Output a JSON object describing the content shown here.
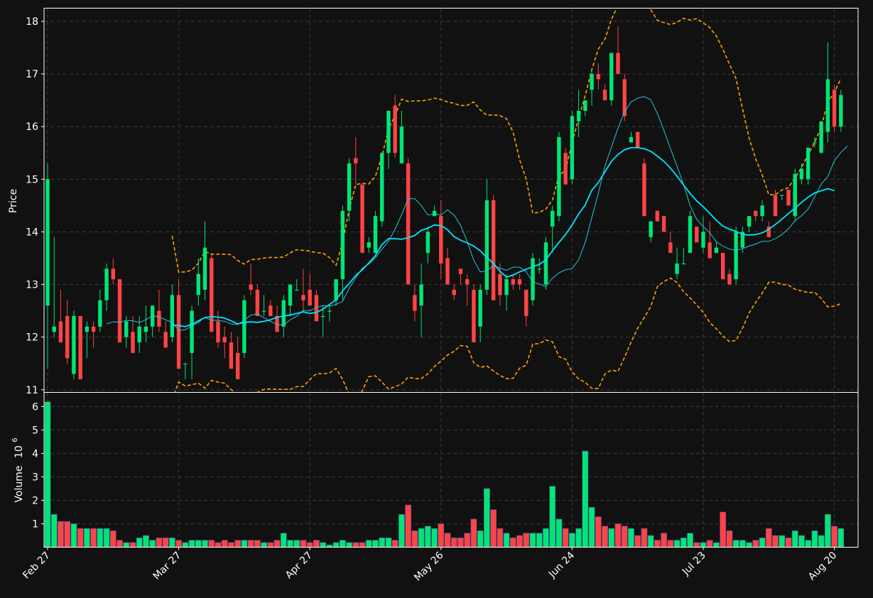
{
  "chart_data": {
    "type": "candlestick",
    "colors": {
      "background": "#111111",
      "up": "#00e676",
      "down": "#ff4444",
      "frame": "#ffffff",
      "grid": "#3a3a3a",
      "bollinger": "#ffa000",
      "ma_short": "#26c6da",
      "ma_long": "#00e5ff"
    },
    "price_panel": {
      "ylabel": "Price",
      "ylim": [
        10.95,
        18.25
      ],
      "yticks": [
        11,
        12,
        13,
        14,
        15,
        16,
        17,
        18
      ]
    },
    "volume_panel": {
      "ylabel": "Volume",
      "ylabel_exponent": "10",
      "ylabel_exponent_power": "6",
      "ylim": [
        0,
        6.6
      ],
      "yticks": [
        1,
        2,
        3,
        4,
        5,
        6
      ]
    },
    "xtick_labels": [
      {
        "index": 0,
        "label": "Feb 27"
      },
      {
        "index": 20,
        "label": "Mar 27"
      },
      {
        "index": 40,
        "label": "Apr 27"
      },
      {
        "index": 60,
        "label": "May 26"
      },
      {
        "index": 80,
        "label": "Jun 24"
      },
      {
        "index": 100,
        "label": "Jul 23"
      },
      {
        "index": 120,
        "label": "Aug 20"
      }
    ],
    "ohlc": [
      [
        12.6,
        15.3,
        11.4,
        15.0
      ],
      [
        12.1,
        13.9,
        12.0,
        12.2
      ],
      [
        12.3,
        12.9,
        11.9,
        11.9
      ],
      [
        12.4,
        12.7,
        11.5,
        11.6
      ],
      [
        11.3,
        12.5,
        11.2,
        12.4
      ],
      [
        12.4,
        12.4,
        11.2,
        11.2
      ],
      [
        12.1,
        12.3,
        11.6,
        12.2
      ],
      [
        12.2,
        12.3,
        11.8,
        12.1
      ],
      [
        12.2,
        12.9,
        12.1,
        12.7
      ],
      [
        12.7,
        13.4,
        12.5,
        13.3
      ],
      [
        13.3,
        13.5,
        13.0,
        13.1
      ],
      [
        13.1,
        13.1,
        12.0,
        11.9
      ],
      [
        12.0,
        12.4,
        11.8,
        12.3
      ],
      [
        12.1,
        12.4,
        11.7,
        11.7
      ],
      [
        11.9,
        12.4,
        11.7,
        12.2
      ],
      [
        12.1,
        12.6,
        11.9,
        12.2
      ],
      [
        12.2,
        12.6,
        12.0,
        12.6
      ],
      [
        12.5,
        12.9,
        12.1,
        12.2
      ],
      [
        12.1,
        12.3,
        11.8,
        11.8
      ],
      [
        12.0,
        13.0,
        11.9,
        12.8
      ],
      [
        12.8,
        13.1,
        11.4,
        11.4
      ],
      [
        11.5,
        11.5,
        11.2,
        11.5
      ],
      [
        11.7,
        12.6,
        11.2,
        12.5
      ],
      [
        12.8,
        13.5,
        12.6,
        13.2
      ],
      [
        12.9,
        14.2,
        12.7,
        13.7
      ],
      [
        13.5,
        13.6,
        12.1,
        12.1
      ],
      [
        12.3,
        12.5,
        11.8,
        11.9
      ],
      [
        12.0,
        12.2,
        11.6,
        11.9
      ],
      [
        11.9,
        12.1,
        11.4,
        11.4
      ],
      [
        11.7,
        12.0,
        11.2,
        11.2
      ],
      [
        11.7,
        12.8,
        11.6,
        12.7
      ],
      [
        13.0,
        13.4,
        12.8,
        12.9
      ],
      [
        12.9,
        13.0,
        12.4,
        12.4
      ],
      [
        12.5,
        12.8,
        12.4,
        12.5
      ],
      [
        12.6,
        12.7,
        12.4,
        12.4
      ],
      [
        12.4,
        12.6,
        12.1,
        12.1
      ],
      [
        12.2,
        12.8,
        12.0,
        12.7
      ],
      [
        12.6,
        13.0,
        12.4,
        13.0
      ],
      [
        12.9,
        13.1,
        12.9,
        12.9
      ],
      [
        12.8,
        13.3,
        12.5,
        12.7
      ],
      [
        12.9,
        13.2,
        12.6,
        12.6
      ],
      [
        12.8,
        12.9,
        12.3,
        12.3
      ],
      [
        12.4,
        12.6,
        12.0,
        12.4
      ],
      [
        12.5,
        12.6,
        12.3,
        12.5
      ],
      [
        12.7,
        13.1,
        12.6,
        13.1
      ],
      [
        13.1,
        14.5,
        12.7,
        14.4
      ],
      [
        14.4,
        15.4,
        14.2,
        15.3
      ],
      [
        15.4,
        15.8,
        14.9,
        15.3
      ],
      [
        14.9,
        14.9,
        13.8,
        13.6
      ],
      [
        13.7,
        13.9,
        13.6,
        13.8
      ],
      [
        13.6,
        14.4,
        13.6,
        14.3
      ],
      [
        14.2,
        15.5,
        14.1,
        15.5
      ],
      [
        15.5,
        16.3,
        15.2,
        16.3
      ],
      [
        16.4,
        16.6,
        15.4,
        15.5
      ],
      [
        15.3,
        16.3,
        15.3,
        16.0
      ],
      [
        15.3,
        15.4,
        13.2,
        13.0
      ],
      [
        12.8,
        13.0,
        12.3,
        12.5
      ],
      [
        12.6,
        13.4,
        12.0,
        13.0
      ],
      [
        13.6,
        14.1,
        13.4,
        14.0
      ],
      [
        14.3,
        14.5,
        14.3,
        14.4
      ],
      [
        14.3,
        14.6,
        13.1,
        13.4
      ],
      [
        13.5,
        13.7,
        13.0,
        13.0
      ],
      [
        12.9,
        13.0,
        12.7,
        12.8
      ],
      [
        13.3,
        13.3,
        13.0,
        13.2
      ],
      [
        13.1,
        13.2,
        12.6,
        13.0
      ],
      [
        12.9,
        13.0,
        11.9,
        11.9
      ],
      [
        12.2,
        13.0,
        11.9,
        12.9
      ],
      [
        12.9,
        15.0,
        12.8,
        14.6
      ],
      [
        14.6,
        14.7,
        12.7,
        12.7
      ],
      [
        13.2,
        13.4,
        12.6,
        12.8
      ],
      [
        12.8,
        13.2,
        12.5,
        13.1
      ],
      [
        13.1,
        13.2,
        12.9,
        13.0
      ],
      [
        13.1,
        13.2,
        12.9,
        13.0
      ],
      [
        12.9,
        12.9,
        12.2,
        12.4
      ],
      [
        12.7,
        13.6,
        12.6,
        13.5
      ],
      [
        13.3,
        13.5,
        13.2,
        13.3
      ],
      [
        13.0,
        13.9,
        12.9,
        13.8
      ],
      [
        14.1,
        14.5,
        13.6,
        14.4
      ],
      [
        14.3,
        15.9,
        14.2,
        15.8
      ],
      [
        15.5,
        15.6,
        15.0,
        14.9
      ],
      [
        15.0,
        16.3,
        14.9,
        16.2
      ],
      [
        16.1,
        16.7,
        15.8,
        16.3
      ],
      [
        16.3,
        16.4,
        16.2,
        16.5
      ],
      [
        16.7,
        17.1,
        16.4,
        17.0
      ],
      [
        17.0,
        17.2,
        16.7,
        16.9
      ],
      [
        16.7,
        16.8,
        16.5,
        16.5
      ],
      [
        16.5,
        17.4,
        16.4,
        17.4
      ],
      [
        17.4,
        17.9,
        17.1,
        17.0
      ],
      [
        16.9,
        17.0,
        16.1,
        16.2
      ],
      [
        15.7,
        15.9,
        15.7,
        15.8
      ],
      [
        15.9,
        15.9,
        15.6,
        15.6
      ],
      [
        15.3,
        15.4,
        14.3,
        14.3
      ],
      [
        13.9,
        14.2,
        13.8,
        14.2
      ],
      [
        14.4,
        14.4,
        14.2,
        14.2
      ],
      [
        14.3,
        14.3,
        14.0,
        14.0
      ],
      [
        13.8,
        14.0,
        13.6,
        13.6
      ],
      [
        13.2,
        13.7,
        13.1,
        13.4
      ],
      [
        13.4,
        13.7,
        13.4,
        13.4
      ],
      [
        13.6,
        14.4,
        13.6,
        14.3
      ],
      [
        14.1,
        14.1,
        13.8,
        13.8
      ],
      [
        13.7,
        14.3,
        13.6,
        14.0
      ],
      [
        13.8,
        14.2,
        13.6,
        13.5
      ],
      [
        13.6,
        13.8,
        13.6,
        13.7
      ],
      [
        13.6,
        13.6,
        13.1,
        13.1
      ],
      [
        13.2,
        13.3,
        13.0,
        13.0
      ],
      [
        13.1,
        14.1,
        13.0,
        14.0
      ],
      [
        13.7,
        14.1,
        13.6,
        14.0
      ],
      [
        14.1,
        14.3,
        14.0,
        14.3
      ],
      [
        14.4,
        14.4,
        14.2,
        14.3
      ],
      [
        14.3,
        14.6,
        14.2,
        14.5
      ],
      [
        14.1,
        14.2,
        13.9,
        13.9
      ],
      [
        14.7,
        14.8,
        14.3,
        14.3
      ],
      [
        14.7,
        14.7,
        14.6,
        14.7
      ],
      [
        14.8,
        14.8,
        14.5,
        14.5
      ],
      [
        14.3,
        15.2,
        14.2,
        15.1
      ],
      [
        15.0,
        15.3,
        14.9,
        15.2
      ],
      [
        15.0,
        15.6,
        14.9,
        15.6
      ],
      [
        15.7,
        15.8,
        15.6,
        15.7
      ],
      [
        15.5,
        16.1,
        15.5,
        16.1
      ],
      [
        15.9,
        17.6,
        15.7,
        16.9
      ],
      [
        16.7,
        16.8,
        15.9,
        16.0
      ],
      [
        16.0,
        16.7,
        15.9,
        16.6
      ]
    ],
    "volume": [
      6.2,
      1.4,
      1.1,
      1.1,
      1.0,
      0.8,
      0.8,
      0.8,
      0.8,
      0.8,
      0.7,
      0.3,
      0.2,
      0.2,
      0.4,
      0.5,
      0.3,
      0.4,
      0.4,
      0.4,
      0.3,
      0.2,
      0.3,
      0.3,
      0.3,
      0.3,
      0.2,
      0.3,
      0.2,
      0.3,
      0.3,
      0.3,
      0.3,
      0.2,
      0.2,
      0.3,
      0.6,
      0.3,
      0.3,
      0.3,
      0.2,
      0.3,
      0.2,
      0.1,
      0.2,
      0.3,
      0.2,
      0.2,
      0.2,
      0.3,
      0.3,
      0.4,
      0.4,
      0.3,
      1.4,
      1.8,
      0.7,
      0.8,
      0.9,
      0.8,
      1.0,
      0.6,
      0.4,
      0.4,
      0.6,
      1.2,
      0.7,
      2.5,
      1.6,
      0.8,
      0.6,
      0.4,
      0.5,
      0.6,
      0.6,
      0.6,
      0.8,
      2.6,
      1.2,
      0.8,
      0.6,
      0.8,
      4.1,
      1.7,
      1.3,
      0.9,
      0.8,
      1.0,
      0.9,
      0.8,
      0.5,
      0.8,
      0.5,
      0.3,
      0.6,
      0.3,
      0.3,
      0.4,
      0.6,
      0.2,
      0.2,
      0.3,
      0.2,
      1.5,
      0.7,
      0.3,
      0.3,
      0.2,
      0.3,
      0.4,
      0.8,
      0.5,
      0.5,
      0.4,
      0.7,
      0.5,
      0.3,
      0.7,
      0.5,
      1.4,
      0.9,
      0.8
    ],
    "ma_short": [
      null,
      null,
      null,
      null,
      null,
      null,
      null,
      null,
      null,
      12.25,
      12.29,
      12.28,
      12.32,
      12.31,
      12.28,
      12.33,
      12.41,
      12.38,
      12.33,
      12.28,
      12.13,
      12.14,
      12.21,
      12.28,
      12.38,
      12.32,
      12.32,
      12.3,
      12.25,
      12.24,
      12.32,
      12.42,
      12.44,
      12.37,
      12.3,
      12.24,
      12.23,
      12.33,
      12.4,
      12.51,
      12.5,
      12.56,
      12.6,
      12.59,
      12.62,
      12.68,
      12.93,
      13.13,
      13.31,
      13.39,
      13.51,
      13.67,
      13.82,
      14.05,
      14.33,
      14.63,
      14.63,
      14.5,
      14.32,
      14.34,
      14.32,
      14.42,
      14.32,
      14.12,
      13.82,
      13.46,
      13.24,
      13.26,
      13.36,
      13.31,
      13.27,
      13.33,
      13.33,
      13.24,
      13.05,
      13.01,
      12.96,
      13.12,
      13.22,
      13.28,
      13.3,
      13.47,
      13.8,
      14.27,
      14.73,
      15.25,
      15.61,
      15.97,
      16.28,
      16.47,
      16.54,
      16.57,
      16.51,
      16.25,
      15.93,
      15.58,
      15.25,
      14.9,
      14.5,
      14.24,
      14.1,
      13.98,
      13.81,
      13.73,
      13.67,
      13.65,
      13.68,
      13.73,
      13.77,
      13.82,
      13.82,
      13.87,
      13.95,
      14.06,
      14.21,
      14.31,
      14.43,
      14.67,
      14.91,
      15.05,
      15.35,
      15.51,
      15.63
    ],
    "ma_long": [
      null,
      null,
      null,
      null,
      null,
      null,
      null,
      null,
      null,
      null,
      null,
      null,
      null,
      null,
      null,
      null,
      null,
      null,
      null,
      12.23,
      12.22,
      12.2,
      12.24,
      12.31,
      12.37,
      12.39,
      12.38,
      12.36,
      12.31,
      12.25,
      12.28,
      12.29,
      12.28,
      12.3,
      12.33,
      12.38,
      12.4,
      12.42,
      12.45,
      12.48,
      12.45,
      12.47,
      12.53,
      12.62,
      12.71,
      12.88,
      13.02,
      13.17,
      13.28,
      13.41,
      13.55,
      13.76,
      13.87,
      13.87,
      13.86,
      13.89,
      13.93,
      14.03,
      14.07,
      14.13,
      14.12,
      14.04,
      13.91,
      13.84,
      13.79,
      13.73,
      13.64,
      13.51,
      13.4,
      13.25,
      13.14,
      13.18,
      13.24,
      13.29,
      13.34,
      13.38,
      13.47,
      13.64,
      13.8,
      13.95,
      14.13,
      14.34,
      14.51,
      14.79,
      14.94,
      15.14,
      15.34,
      15.47,
      15.56,
      15.6,
      15.6,
      15.58,
      15.53,
      15.44,
      15.34,
      15.21,
      15.06,
      14.89,
      14.73,
      14.59,
      14.48,
      14.35,
      14.22,
      14.11,
      14.05,
      14.01,
      13.95,
      13.94,
      13.95,
      13.98,
      14.05,
      14.14,
      14.24,
      14.35,
      14.45,
      14.56,
      14.66,
      14.74,
      14.78,
      14.82,
      14.78
    ]
  }
}
